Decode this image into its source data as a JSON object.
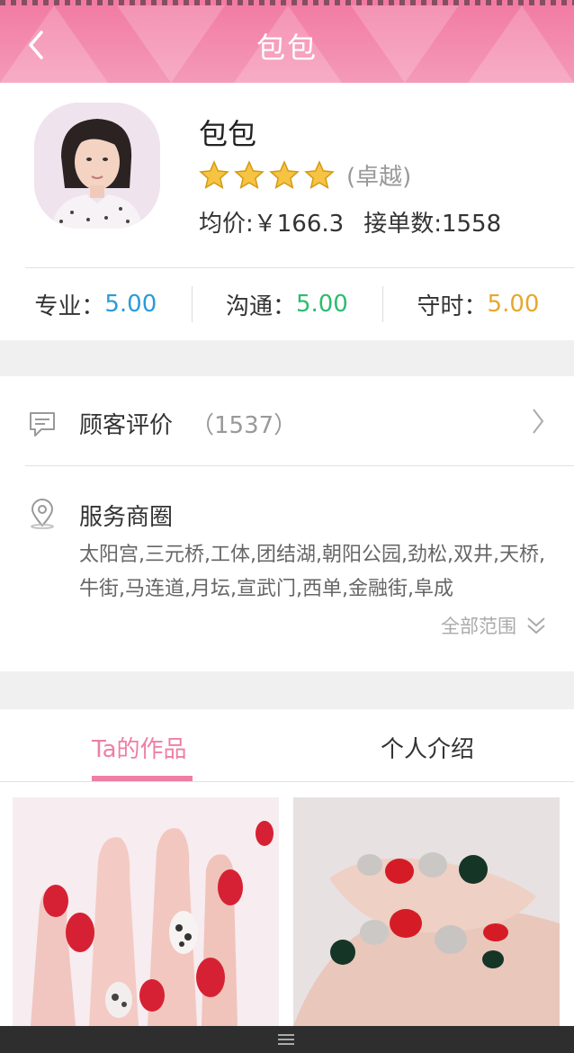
{
  "header": {
    "title": "包包"
  },
  "profile": {
    "name": "包包",
    "rating_stars": 4,
    "level": "(卓越)",
    "avg_price": "均价:￥166.3",
    "orders": "接单数:1558"
  },
  "scores": [
    {
      "label": "专业：",
      "value": "5.00",
      "color": "#2a9bd8"
    },
    {
      "label": "沟通：",
      "value": "5.00",
      "color": "#2dbc6f"
    },
    {
      "label": "守时：",
      "value": "5.00",
      "color": "#e6a82c"
    }
  ],
  "reviews": {
    "label": "顾客评价",
    "count": "（1537）"
  },
  "service_area": {
    "title": "服务商圈",
    "text": "太阳宫,三元桥,工体,团结湖,朝阳公园,劲松,双井,天桥,牛街,马连道,月坛,宣武门,西单,金融街,阜成",
    "more_label": "全部范围"
  },
  "tabs": [
    {
      "label": "Ta的作品",
      "active": true
    },
    {
      "label": "个人介绍",
      "active": false
    }
  ],
  "colors": {
    "accent": "#ee7fa4",
    "header_bg": "#f27aa2",
    "star": "#f6c343"
  },
  "icons": [
    "back-icon",
    "star-icon",
    "comment-icon",
    "location-pin-icon",
    "chevron-right-icon",
    "double-chevron-down-icon",
    "menu-grip-icon"
  ]
}
